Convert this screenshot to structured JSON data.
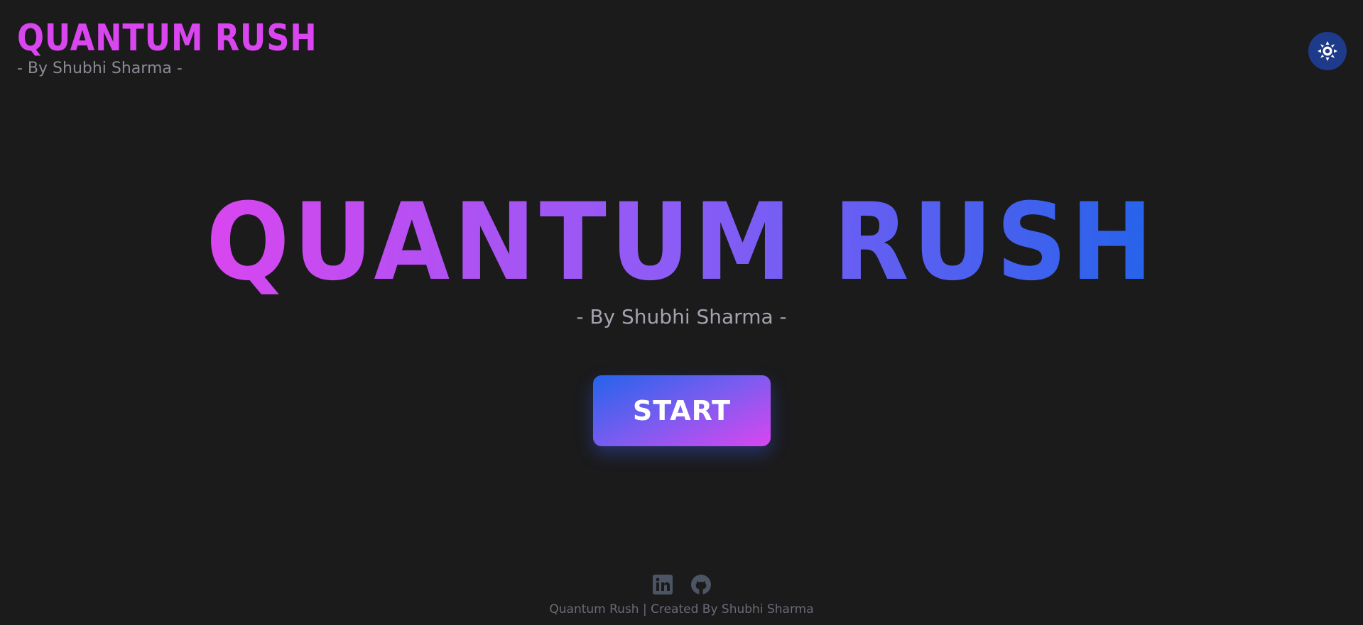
{
  "header": {
    "title": "QUANTUM RUSH",
    "subtitle": "- By Shubhi Sharma -",
    "theme_toggle_icon": "sun-icon"
  },
  "hero": {
    "title": "QUANTUM RUSH",
    "subtitle": "- By Shubhi Sharma -",
    "start_label": "START"
  },
  "footer": {
    "icons": [
      "linkedin-icon",
      "github-icon"
    ],
    "text": "Quantum Rush | Created By Shubhi Sharma"
  },
  "colors": {
    "background": "#1b1b1c",
    "accent_pink": "#d946ef",
    "accent_purple": "#8b5cf6",
    "accent_blue": "#2563eb",
    "toggle_bg": "#1e3a8a"
  }
}
